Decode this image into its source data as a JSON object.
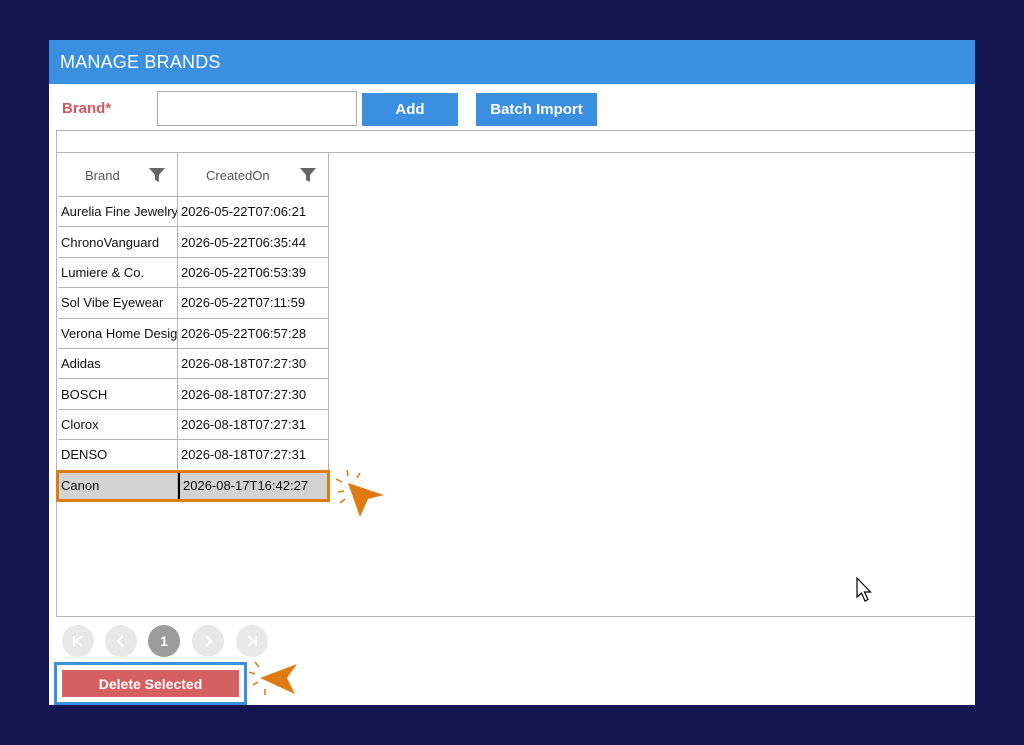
{
  "window": {
    "title": "MANAGE BRANDS"
  },
  "form": {
    "brand_label": "Brand*",
    "brand_value": "",
    "add_label": "Add",
    "batch_import_label": "Batch Import"
  },
  "grid": {
    "columns": [
      "Brand",
      "CreatedOn"
    ],
    "rows": [
      {
        "brand": "Aurelia Fine Jewelry",
        "created": "2026-05-22T07:06:21"
      },
      {
        "brand": "ChronoVanguard",
        "created": "2026-05-22T06:35:44"
      },
      {
        "brand": "Lumiere & Co.",
        "created": "2026-05-22T06:53:39"
      },
      {
        "brand": "Sol Vibe Eyewear",
        "created": "2026-05-22T07:11:59"
      },
      {
        "brand": "Verona Home Design",
        "created": "2026-05-22T06:57:28"
      },
      {
        "brand": "Adidas",
        "created": "2026-08-18T07:27:30"
      },
      {
        "brand": "BOSCH",
        "created": "2026-08-18T07:27:30"
      },
      {
        "brand": "Clorox",
        "created": "2026-08-18T07:27:31"
      },
      {
        "brand": "DENSO",
        "created": "2026-08-18T07:27:31"
      },
      {
        "brand": "Canon",
        "created": "2026-08-17T16:42:27"
      }
    ],
    "selected_row": "Canon"
  },
  "pager": {
    "first": "|<",
    "prev": "<",
    "current_page": "1",
    "next": ">",
    "last": ">|"
  },
  "actions": {
    "delete_selected_label": "Delete Selected"
  },
  "colors": {
    "background": "#131650",
    "accent_blue": "#3a8fe0",
    "delete_red": "#d46060",
    "annotation_orange": "#e07a12",
    "label_red": "#d0595f"
  }
}
